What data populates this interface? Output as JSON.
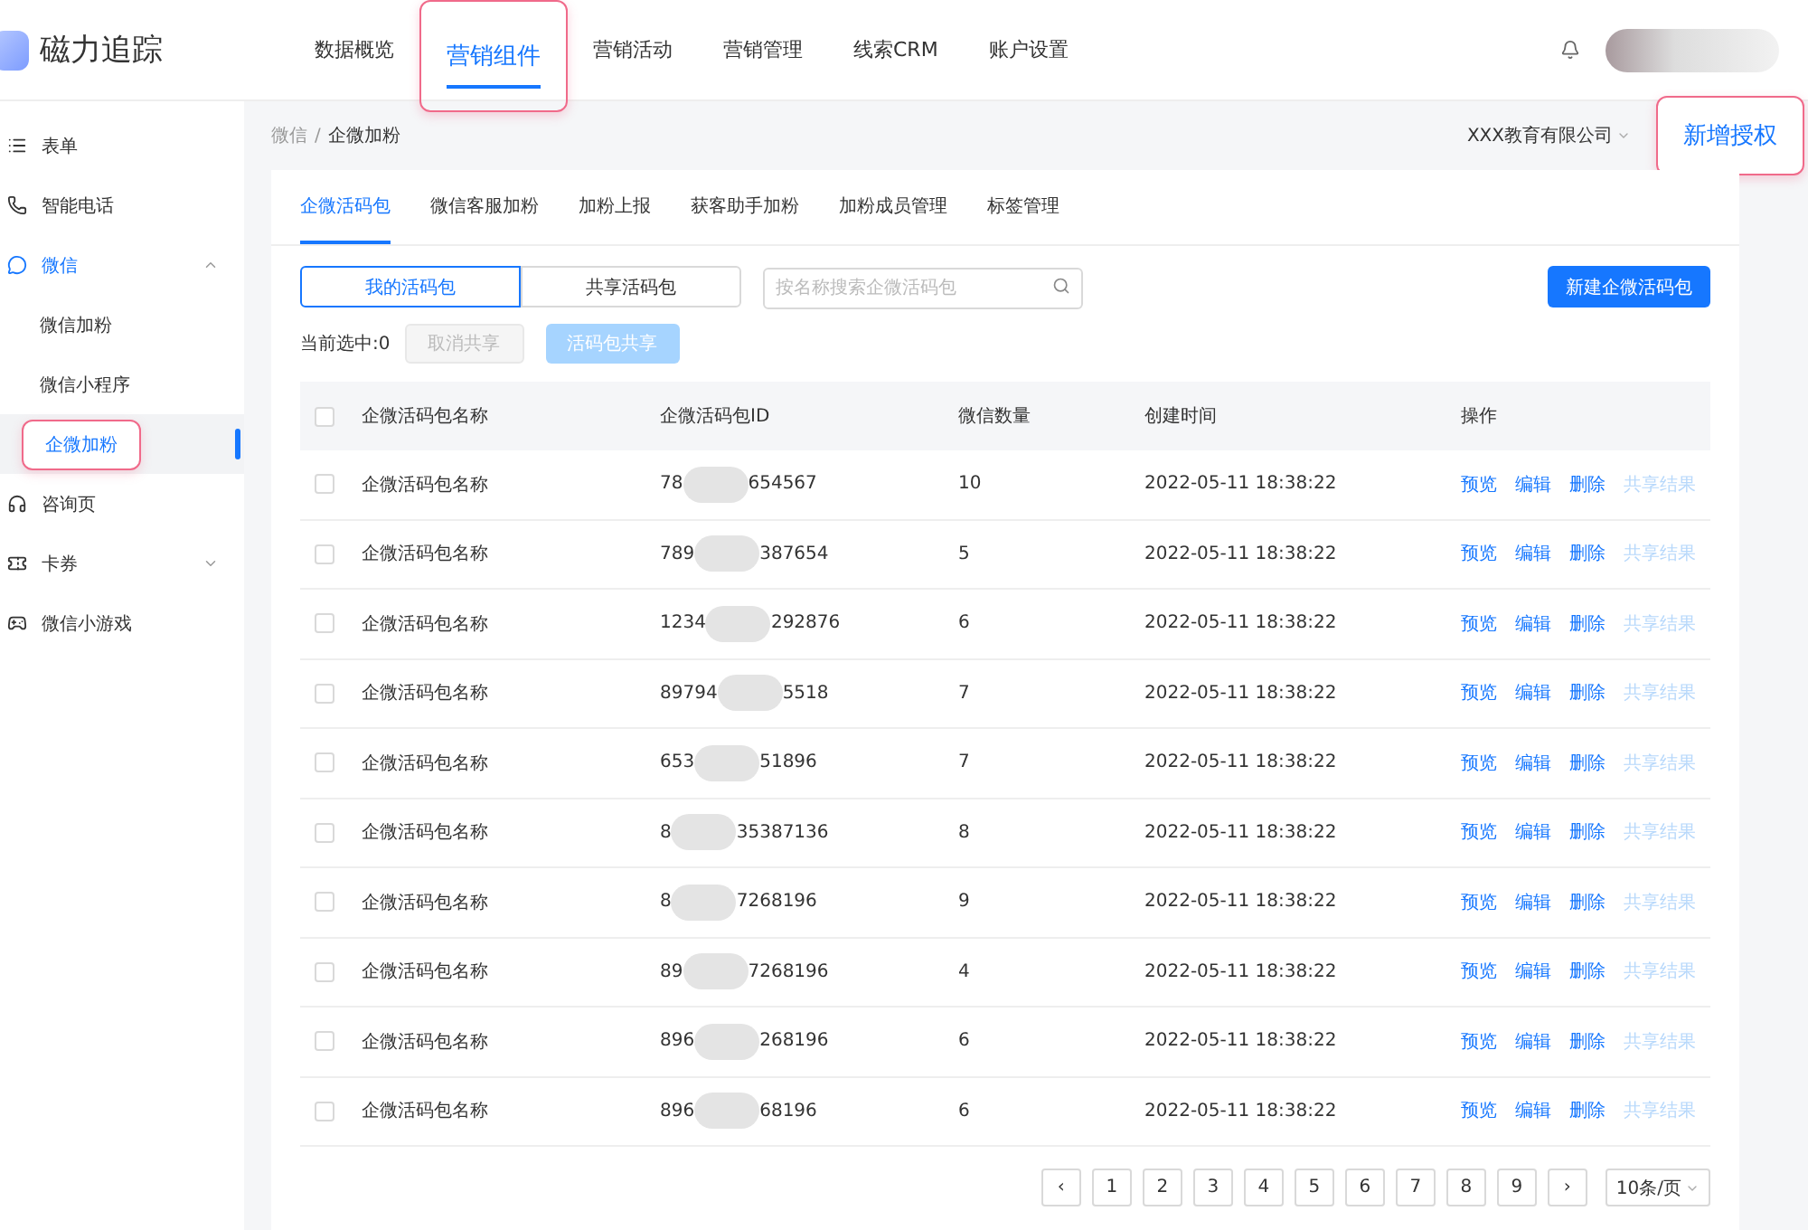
{
  "app": {
    "name": "磁力追踪"
  },
  "nav": [
    {
      "label": "数据概览",
      "selected": false
    },
    {
      "label": "营销组件",
      "selected": true
    },
    {
      "label": "营销活动",
      "selected": false
    },
    {
      "label": "营销管理",
      "selected": false
    },
    {
      "label": "线索CRM",
      "selected": false
    },
    {
      "label": "账户设置",
      "selected": false
    }
  ],
  "sidebar": {
    "items": [
      {
        "label": "表单",
        "kind": "list",
        "selected": false
      },
      {
        "label": "智能电话",
        "kind": "phone",
        "selected": false
      },
      {
        "label": "微信",
        "kind": "chat",
        "expanded": true,
        "selected": true,
        "children": [
          {
            "label": "微信加粉",
            "selected": false
          },
          {
            "label": "微信小程序",
            "selected": false
          },
          {
            "label": "企微加粉",
            "selected": true
          }
        ]
      },
      {
        "label": "咨询页",
        "kind": "headset",
        "selected": false
      },
      {
        "label": "卡券",
        "kind": "ticket",
        "expanded": false,
        "selected": false
      },
      {
        "label": "微信小游戏",
        "kind": "gamepad",
        "selected": false
      }
    ]
  },
  "breadcrumb": {
    "parent": "微信",
    "separator": "/",
    "current": "企微加粉"
  },
  "company": "XXX教育有限公司",
  "add_auth_button": "新增授权",
  "tabs": [
    {
      "label": "企微活码包",
      "selected": true
    },
    {
      "label": "微信客服加粉",
      "selected": false
    },
    {
      "label": "加粉上报",
      "selected": false
    },
    {
      "label": "获客助手加粉",
      "selected": false
    },
    {
      "label": "加粉成员管理",
      "selected": false
    },
    {
      "label": "标签管理",
      "selected": false
    }
  ],
  "segments": [
    {
      "label": "我的活码包",
      "selected": true
    },
    {
      "label": "共享活码包",
      "selected": false
    }
  ],
  "search": {
    "placeholder": "按名称搜索企微活码包"
  },
  "create_button": "新建企微活码包",
  "selection_count": "当前选中:0",
  "bulk_buttons": [
    {
      "label": "取消共享",
      "kind": "gray"
    },
    {
      "label": "活码包共享",
      "kind": "blue"
    }
  ],
  "table": {
    "header_checked": false,
    "columns": [
      "企微活码包名称",
      "企微活码包ID",
      "微信数量",
      "创建时间",
      "操作"
    ],
    "rows": [
      {
        "checked": false,
        "name": "企微活码包名称",
        "id_start": "78",
        "id_end": "654567",
        "count": "10",
        "created": "2022-05-11 18:38:22",
        "actions": [
          {
            "label": "预览",
            "disabled": false
          },
          {
            "label": "编辑",
            "disabled": false
          },
          {
            "label": "删除",
            "disabled": false
          },
          {
            "label": "共享结果",
            "disabled": true
          }
        ]
      },
      {
        "checked": false,
        "name": "企微活码包名称",
        "id_start": "789",
        "id_end": "387654",
        "count": "5",
        "created": "2022-05-11 18:38:22",
        "actions": [
          {
            "label": "预览",
            "disabled": false
          },
          {
            "label": "编辑",
            "disabled": false
          },
          {
            "label": "删除",
            "disabled": false
          },
          {
            "label": "共享结果",
            "disabled": true
          }
        ]
      },
      {
        "checked": false,
        "name": "企微活码包名称",
        "id_start": "1234",
        "id_end": "292876",
        "count": "6",
        "created": "2022-05-11 18:38:22",
        "actions": [
          {
            "label": "预览",
            "disabled": false
          },
          {
            "label": "编辑",
            "disabled": false
          },
          {
            "label": "删除",
            "disabled": false
          },
          {
            "label": "共享结果",
            "disabled": true
          }
        ]
      },
      {
        "checked": false,
        "name": "企微活码包名称",
        "id_start": "89794",
        "id_end": "5518",
        "count": "7",
        "created": "2022-05-11 18:38:22",
        "actions": [
          {
            "label": "预览",
            "disabled": false
          },
          {
            "label": "编辑",
            "disabled": false
          },
          {
            "label": "删除",
            "disabled": false
          },
          {
            "label": "共享结果",
            "disabled": true
          }
        ]
      },
      {
        "checked": false,
        "name": "企微活码包名称",
        "id_start": "653",
        "id_end": "51896",
        "count": "7",
        "created": "2022-05-11 18:38:22",
        "actions": [
          {
            "label": "预览",
            "disabled": false
          },
          {
            "label": "编辑",
            "disabled": false
          },
          {
            "label": "删除",
            "disabled": false
          },
          {
            "label": "共享结果",
            "disabled": true
          }
        ]
      },
      {
        "checked": false,
        "name": "企微活码包名称",
        "id_start": "8",
        "id_end": "35387136",
        "count": "8",
        "created": "2022-05-11 18:38:22",
        "actions": [
          {
            "label": "预览",
            "disabled": false
          },
          {
            "label": "编辑",
            "disabled": false
          },
          {
            "label": "删除",
            "disabled": false
          },
          {
            "label": "共享结果",
            "disabled": true
          }
        ]
      },
      {
        "checked": false,
        "name": "企微活码包名称",
        "id_start": "8",
        "id_end": "7268196",
        "count": "9",
        "created": "2022-05-11 18:38:22",
        "actions": [
          {
            "label": "预览",
            "disabled": false
          },
          {
            "label": "编辑",
            "disabled": false
          },
          {
            "label": "删除",
            "disabled": false
          },
          {
            "label": "共享结果",
            "disabled": true
          }
        ]
      },
      {
        "checked": false,
        "name": "企微活码包名称",
        "id_start": "89",
        "id_end": "7268196",
        "count": "4",
        "created": "2022-05-11 18:38:22",
        "actions": [
          {
            "label": "预览",
            "disabled": false
          },
          {
            "label": "编辑",
            "disabled": false
          },
          {
            "label": "删除",
            "disabled": false
          },
          {
            "label": "共享结果",
            "disabled": true
          }
        ]
      },
      {
        "checked": false,
        "name": "企微活码包名称",
        "id_start": "896",
        "id_end": "268196",
        "count": "6",
        "created": "2022-05-11 18:38:22",
        "actions": [
          {
            "label": "预览",
            "disabled": false
          },
          {
            "label": "编辑",
            "disabled": false
          },
          {
            "label": "删除",
            "disabled": false
          },
          {
            "label": "共享结果",
            "disabled": true
          }
        ]
      },
      {
        "checked": false,
        "name": "企微活码包名称",
        "id_start": "896",
        "id_end": "68196",
        "count": "6",
        "created": "2022-05-11 18:38:22",
        "actions": [
          {
            "label": "预览",
            "disabled": false
          },
          {
            "label": "编辑",
            "disabled": false
          },
          {
            "label": "删除",
            "disabled": false
          },
          {
            "label": "共享结果",
            "disabled": true
          }
        ]
      }
    ]
  },
  "pagination": {
    "prev": "‹",
    "pages": [
      "1",
      "2",
      "3",
      "4",
      "5",
      "6",
      "7",
      "8",
      "9"
    ],
    "next": "›",
    "page_size": "10条/页"
  }
}
